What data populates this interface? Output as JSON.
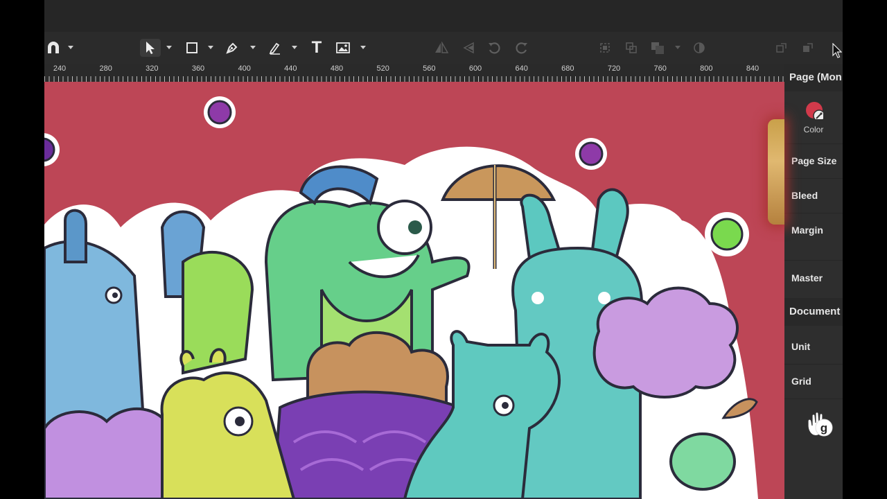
{
  "toolbar": {
    "tools": [
      {
        "name": "magnet-icon",
        "label": "Snapping"
      },
      {
        "name": "select-arrow-icon",
        "label": "Select"
      },
      {
        "name": "rectangle-icon",
        "label": "Shape"
      },
      {
        "name": "pen-icon",
        "label": "Pen"
      },
      {
        "name": "pencil-icon",
        "label": "Pencil"
      },
      {
        "name": "text-icon",
        "label": "T"
      },
      {
        "name": "image-icon",
        "label": "Image"
      }
    ]
  },
  "ruler": {
    "labels": [
      "240",
      "280",
      "320",
      "360",
      "400",
      "440",
      "480",
      "520",
      "560",
      "600",
      "640",
      "680",
      "720",
      "760",
      "800",
      "840"
    ]
  },
  "panel": {
    "page_header": "Page (Mon",
    "color_label": "Color",
    "page_color": "#d13a4b",
    "rows": {
      "page_size": "Page Size",
      "bleed": "Bleed",
      "margin": "Margin",
      "master": "Master"
    },
    "document_header": "Document",
    "doc_rows": {
      "unit": "Unit",
      "grid": "Grid"
    },
    "badge_letter": "g"
  },
  "colors": {
    "canvas_bg": "#bd4656",
    "toolbar_bg": "#2b2b2b",
    "panel_bg": "#2e2e2e"
  }
}
